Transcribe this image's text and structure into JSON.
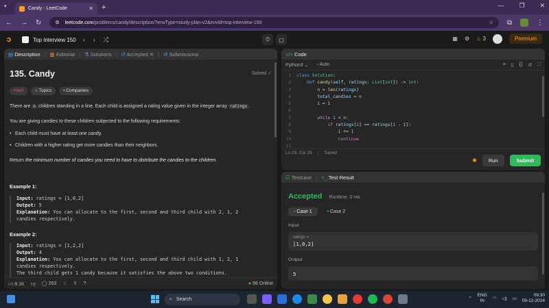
{
  "browser": {
    "tab_title": "Candy - LeetCode",
    "url_domain": "leetcode.com",
    "url_path": "/problems/candy/description/?envType=study-plan-v2&envId=top-interview-150"
  },
  "lc_header": {
    "problem_list": "Top Interview 150",
    "streak_count": "3",
    "premium_label": "Premium"
  },
  "desc_tabs": {
    "description": "Description",
    "editorial": "Editorial",
    "solutions": "Solutions",
    "accepted": "Accepted",
    "submissions": "Submissions"
  },
  "problem": {
    "title": "135. Candy",
    "status": "Solved",
    "difficulty": "Hard",
    "topics": "Topics",
    "companies": "Companies",
    "p1_a": "There are ",
    "p1_code1": "n",
    "p1_b": " children standing in a line. Each child is assigned a rating value given in the integer array ",
    "p1_code2": "ratings",
    "p1_c": ".",
    "p2": "You are giving candies to these children subjected to the following requirements:",
    "req1": "Each child must have at least one candy.",
    "req2": "Children with a higher rating get more candies than their neighbors.",
    "p3_a": "Return ",
    "p3_em": "the minimum number of candies you need to have to distribute the candies to the children",
    "p3_b": ".",
    "ex1_title": "Example 1:",
    "ex1_input_label": "Input:",
    "ex1_input": " ratings = [1,0,2]",
    "ex1_output_label": "Output:",
    "ex1_output": " 5",
    "ex1_expl_label": "Explanation:",
    "ex1_expl": " You can allocate to the first, second and third child with 2, 1, 2",
    "ex1_expl2": "candies respectively.",
    "ex2_title": "Example 2:",
    "ex2_input_label": "Input:",
    "ex2_input": " ratings = [1,2,2]",
    "ex2_output_label": "Output:",
    "ex2_output": " 4",
    "ex2_expl_label": "Explanation:",
    "ex2_expl": " You can allocate to the first, second and third child with 1, 2, 1",
    "ex2_expl2": "candies respectively.",
    "ex2_expl3": "The third child gets 1 candy because it satisfies the above two conditions."
  },
  "desc_footer": {
    "likes": "8.1K",
    "comments": "263",
    "online": "98 Online"
  },
  "code_panel": {
    "title": "Code",
    "language": "Python3",
    "mode": "Auto",
    "status_pos": "Ln 29, Col 29",
    "status_saved": "Saved",
    "run": "Run",
    "submit": "Submit"
  },
  "result_panel": {
    "testcase_tab": "Testcase",
    "result_tab": "Test Result",
    "verdict": "Accepted",
    "runtime": "Runtime: 0 ms",
    "case1": "Case 1",
    "case2": "Case 2",
    "input_label": "Input",
    "input_key": "ratings =",
    "input_value": "[1,0,2]",
    "output_label": "Output",
    "output_value": "5"
  },
  "taskbar": {
    "search": "Search",
    "lang1": "ENG",
    "lang2": "IN",
    "time": "09:30",
    "date": "09-12-2024"
  },
  "colors": {
    "accent_green": "#2cbb5d",
    "brand_orange": "#ffa116",
    "hard_red": "#ff375f"
  }
}
